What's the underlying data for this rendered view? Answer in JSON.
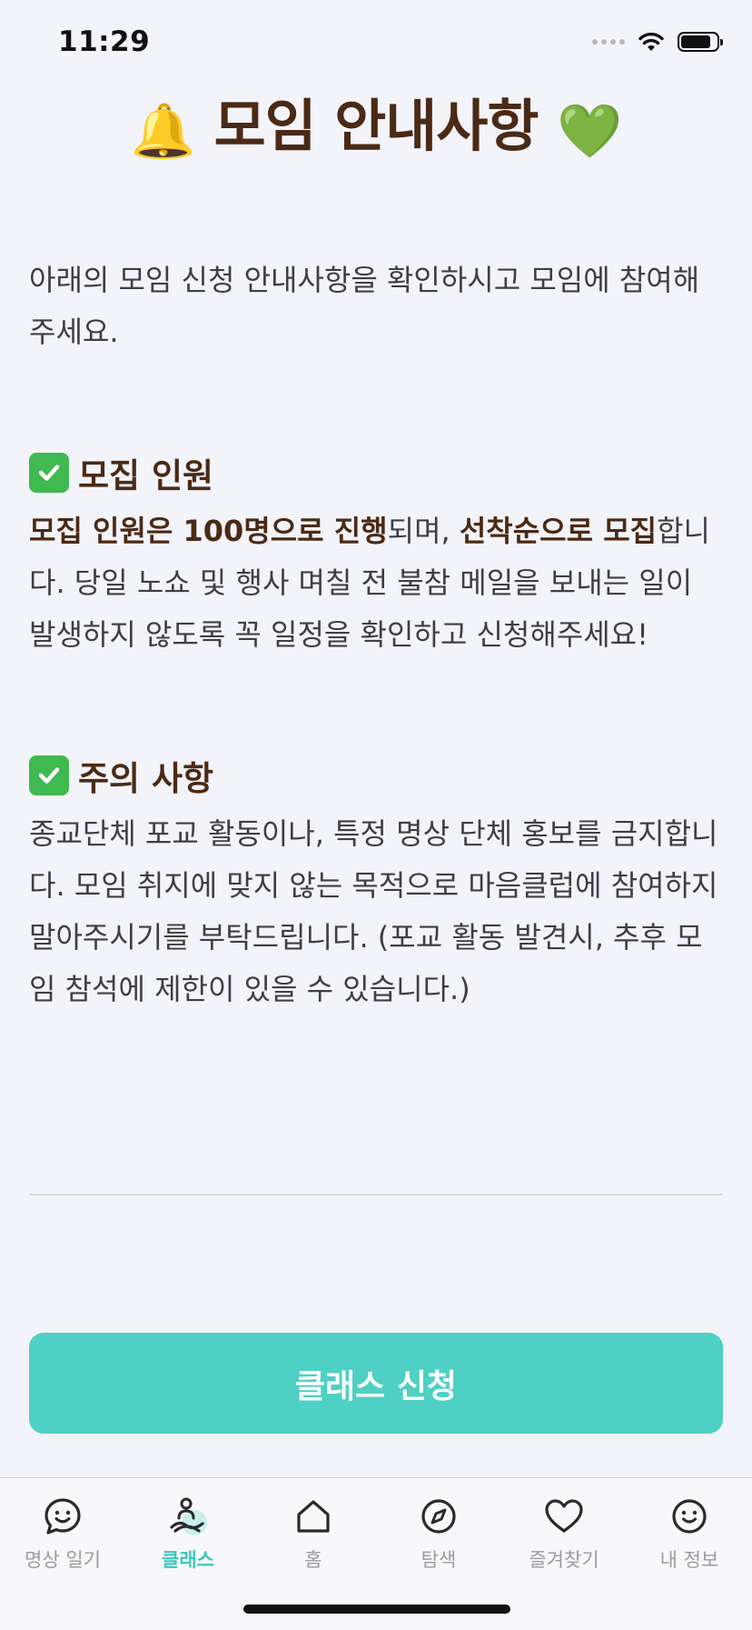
{
  "status_bar": {
    "time": "11:29"
  },
  "header": {
    "title_prefix_emoji": "🔔",
    "title": "모임 안내사항",
    "title_suffix_emoji": "💚"
  },
  "intro": "아래의 모임 신청 안내사항을 확인하시고 모임에 참여해주세요.",
  "sections": [
    {
      "heading": "모집 인원",
      "body_parts": [
        {
          "text": "모집 인원은 100명으로 진행",
          "bold": true
        },
        {
          "text": "되며, ",
          "bold": false
        },
        {
          "text": "선착순으로 모집",
          "bold": true
        },
        {
          "text": "합니다. 당일 노쇼 및 행사 며칠 전 불참 메일을 보내는 일이 발생하지 않도록 꼭 일정을 확인하고 신청해주세요!",
          "bold": false
        }
      ]
    },
    {
      "heading": "주의 사항",
      "body_parts": [
        {
          "text": "종교단체 포교 활동이나, 특정 명상 단체 홍보를 금지합니다. 모임 취지에 맞지 않는 목적으로 마음클럽에 참여하지 말아주시기를 부탁드립니다. (포교 활동 발견시, 추후 모임 참석에 제한이 있을 수 있습니다.)",
          "bold": false
        }
      ]
    }
  ],
  "apply_button": {
    "label": "클래스 신청"
  },
  "tab_bar": {
    "items": [
      {
        "label": "명상 일기",
        "icon": "chat-smile-icon",
        "active": false
      },
      {
        "label": "클래스",
        "icon": "meditation-person-icon",
        "active": true
      },
      {
        "label": "홈",
        "icon": "home-icon",
        "active": false
      },
      {
        "label": "탐색",
        "icon": "compass-icon",
        "active": false
      },
      {
        "label": "즐겨찾기",
        "icon": "heart-icon",
        "active": false
      },
      {
        "label": "내 정보",
        "icon": "smile-face-icon",
        "active": false
      }
    ]
  },
  "colors": {
    "background": "#f3f3fa",
    "accent": "#4ed0c4",
    "heading_brown": "#4a2a15",
    "check_green": "#3fb950"
  }
}
